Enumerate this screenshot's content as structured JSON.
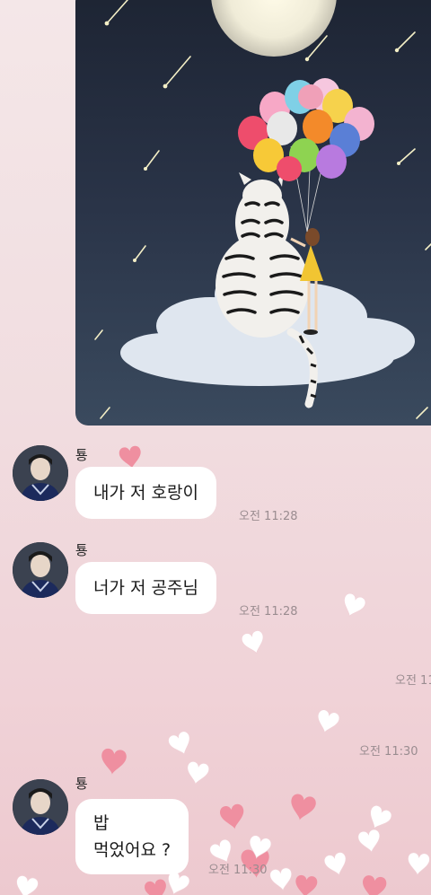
{
  "colors": {
    "background": "#f2dfe2",
    "bubble": "#ffffff",
    "timestamp": "#9a8c90",
    "heart_pink": "#ee8a9c",
    "heart_white": "#ffffff"
  },
  "shared_image": {
    "icon": "tiger-girl-balloons-painting-icon"
  },
  "messages": [
    {
      "sender": "툥",
      "lines": [
        "내가 저 호랑이"
      ],
      "time": "오전 11:28"
    },
    {
      "sender": "툥",
      "lines": [
        "너가 저 공주님"
      ],
      "time": "오전 11:28"
    },
    {
      "sender": "툥",
      "lines": [
        "밥",
        "먹었어요 ?"
      ],
      "time": "오전 11:30"
    }
  ],
  "orphan_times": [
    "오전 11",
    "오전 11:30"
  ]
}
